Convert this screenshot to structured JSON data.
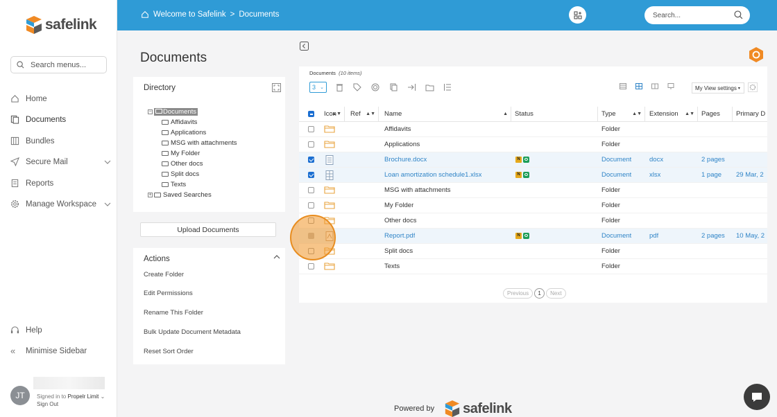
{
  "app": {
    "name": "safelink",
    "accent": "#2f9bd6",
    "highlight": "#e88d20"
  },
  "sidebar": {
    "search_placeholder": "Search menus...",
    "items": [
      {
        "label": "Home",
        "icon": "home-icon"
      },
      {
        "label": "Documents",
        "icon": "documents-icon"
      },
      {
        "label": "Bundles",
        "icon": "bundles-icon"
      },
      {
        "label": "Secure Mail",
        "icon": "send-icon"
      },
      {
        "label": "Reports",
        "icon": "reports-icon"
      },
      {
        "label": "Manage Workspace",
        "icon": "gear-icon"
      }
    ],
    "help": "Help",
    "minimise": "Minimise Sidebar",
    "user": {
      "initials": "JT",
      "signed_in_to": "Signed in to",
      "org": "Propelr Limit",
      "sign_out": "Sign Out"
    }
  },
  "topbar": {
    "breadcrumb_home": "Welcome to Safelink",
    "separator": ">",
    "breadcrumb_current": "Documents",
    "search_placeholder": "Search..."
  },
  "page_title": "Documents",
  "directory": {
    "title": "Directory",
    "root": "Documents",
    "folders": [
      "Affidavits",
      "Applications",
      "MSG with attachments",
      "My Folder",
      "Other docs",
      "Split docs",
      "Texts"
    ],
    "saved_searches": "Saved Searches"
  },
  "upload_label": "Upload Documents",
  "actions": {
    "title": "Actions",
    "items": [
      "Create Folder",
      "Edit Permissions",
      "Rename This Folder",
      "Bulk Update Document Metadata",
      "Reset Sort Order"
    ]
  },
  "grid": {
    "label": "Documents",
    "count": "(10 items)",
    "page_size": "3",
    "view_settings": "My View settings",
    "columns": {
      "icon": "Icon",
      "ref": "Ref",
      "name": "Name",
      "status": "Status",
      "type": "Type",
      "extension": "Extension",
      "pages": "Pages",
      "primary_date": "Primary D"
    },
    "rows": [
      {
        "name": "Affidavits",
        "type": "Folder",
        "ext": "",
        "pages": "",
        "date": ""
      },
      {
        "name": "Applications",
        "type": "Folder",
        "ext": "",
        "pages": "",
        "date": ""
      },
      {
        "name": "Brochure.docx",
        "type": "Document",
        "ext": "docx",
        "pages": "2 pages",
        "date": ""
      },
      {
        "name": "Loan amortization schedule1.xlsx",
        "type": "Document",
        "ext": "xlsx",
        "pages": "1 page",
        "date": "29 Mar, 2"
      },
      {
        "name": "MSG with attachments",
        "type": "Folder",
        "ext": "",
        "pages": "",
        "date": ""
      },
      {
        "name": "My Folder",
        "type": "Folder",
        "ext": "",
        "pages": "",
        "date": ""
      },
      {
        "name": "Other docs",
        "type": "Folder",
        "ext": "",
        "pages": "",
        "date": ""
      },
      {
        "name": "Report.pdf",
        "type": "Document",
        "ext": "pdf",
        "pages": "2 pages",
        "date": "10 May, 2"
      },
      {
        "name": "Split docs",
        "type": "Folder",
        "ext": "",
        "pages": "",
        "date": ""
      },
      {
        "name": "Texts",
        "type": "Folder",
        "ext": "",
        "pages": "",
        "date": ""
      }
    ],
    "badge_n": "N",
    "pager": {
      "prev": "Previous",
      "page": "1",
      "next": "Next"
    }
  },
  "footer": {
    "powered_by": "Powered by",
    "brand": "safelink"
  }
}
